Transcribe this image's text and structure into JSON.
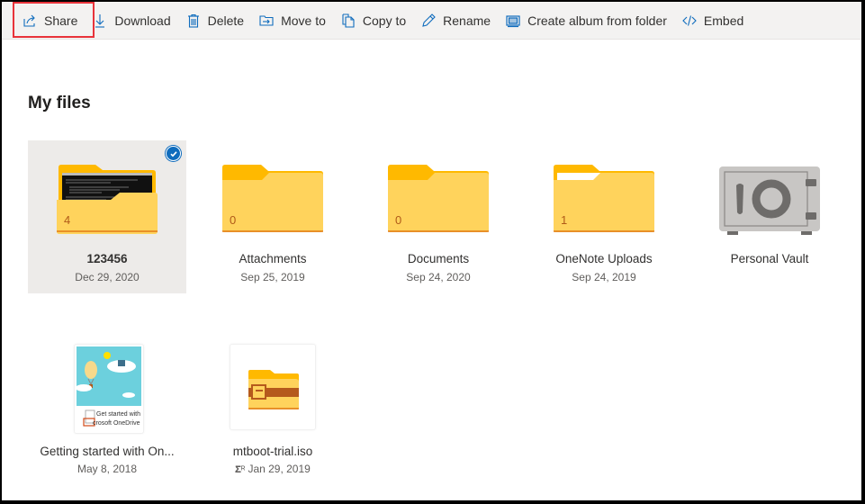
{
  "toolbar": {
    "items": [
      {
        "id": "share",
        "label": "Share",
        "icon": "share-icon"
      },
      {
        "id": "download",
        "label": "Download",
        "icon": "download-icon"
      },
      {
        "id": "delete",
        "label": "Delete",
        "icon": "trash-icon"
      },
      {
        "id": "move",
        "label": "Move to",
        "icon": "move-to-icon"
      },
      {
        "id": "copy",
        "label": "Copy to",
        "icon": "copy-icon"
      },
      {
        "id": "rename",
        "label": "Rename",
        "icon": "pencil-icon"
      },
      {
        "id": "album",
        "label": "Create album from folder",
        "icon": "album-icon"
      },
      {
        "id": "embed",
        "label": "Embed",
        "icon": "code-icon"
      }
    ],
    "highlighted": "share",
    "accent_color": "#0f6cbd",
    "highlight_color": "#e8333a"
  },
  "page": {
    "title": "My files"
  },
  "items": [
    {
      "name": "123456",
      "date": "Dec 29, 2020",
      "type": "folder",
      "count": "4",
      "selected": true,
      "has_preview": true
    },
    {
      "name": "Attachments",
      "date": "Sep 25, 2019",
      "type": "folder",
      "count": "0",
      "selected": false
    },
    {
      "name": "Documents",
      "date": "Sep 24, 2020",
      "type": "folder",
      "count": "0",
      "selected": false
    },
    {
      "name": "OneNote Uploads",
      "date": "Sep 24, 2019",
      "type": "folder",
      "count": "1",
      "selected": false
    },
    {
      "name": "Personal Vault",
      "date": "",
      "type": "vault",
      "selected": false
    },
    {
      "name": "Getting started with On...",
      "date": "May 8, 2018",
      "type": "pdf",
      "preview_caption_1": "Get started with",
      "preview_caption_2": "crosoft OneDrive",
      "selected": false
    },
    {
      "name": "mtboot-trial.iso",
      "date": "Jan 29, 2019",
      "type": "archive",
      "shared": true,
      "selected": false
    }
  ]
}
